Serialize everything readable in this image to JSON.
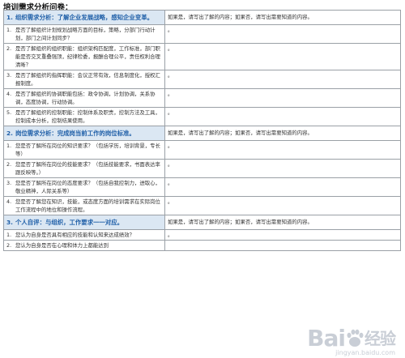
{
  "title": "培训需求分析问卷：",
  "note_text": "如果是，请写出了解的内容；如果否，请写出需要知道的内容。",
  "sections": [
    {
      "num": "1.",
      "heading": "组织需求分析：了解企业发展战略，感知企业变革。",
      "items": [
        {
          "num": "1.",
          "text": "是否了解组织计划规划战略方面的目标，策略，分部门行动计划，部门之间计划同步？"
        },
        {
          "num": "2.",
          "text": "是否了解组织的组织职能：组织架构匹配度，工作标准，部门职能是否交叉重叠强顶，纪律检委，报酬合理公平，责任权利合理清晰？"
        },
        {
          "num": "3.",
          "text": "是否了解组织的指挥职能：会议正常有效，信息制度化，授权汇报制度。"
        },
        {
          "num": "4.",
          "text": "是否了解组织的协调职能包括：政令协调，计划协调，关系协调，态度协调，行动协调。"
        },
        {
          "num": "5.",
          "text": "是否了解组织的控制职能：控制体系及职责，控制方法及工具，控制成本分析，控制结果使用。"
        }
      ]
    },
    {
      "num": "2.",
      "heading": "岗位需求分析：完成岗当前工作的岗位标准。",
      "items": [
        {
          "num": "1.",
          "text": "您是否了解所在岗位的知识要求？（包括学历，培训背景，专长等）"
        },
        {
          "num": "2.",
          "text": "您是否了解所在岗位的技能要求？（包括技能要求，书面表达率跟反映等。）"
        },
        {
          "num": "3.",
          "text": "您是否了解所在岗位的态度要求？（包括自我控制力，进取心，敬业精神，人际关系等）"
        },
        {
          "num": "4.",
          "text": "您是否了解您在知识，技能，或态度方面的培训需求在实际岗位工作流程中的地位和操作流程。"
        }
      ]
    },
    {
      "num": "3.",
      "heading": "个人自评：与组织，工作要求一一对应。",
      "items": [
        {
          "num": "1.",
          "text": "您认为自身是否具有相应的技能和认知来达成绩效？"
        },
        {
          "num": "2.",
          "text": "您认为自身是否在心理和体力上都能达到"
        }
      ]
    }
  ],
  "watermark": {
    "logo_left": "Bai",
    "logo_right": "经验",
    "sub": "jingyan.baidu.com"
  }
}
